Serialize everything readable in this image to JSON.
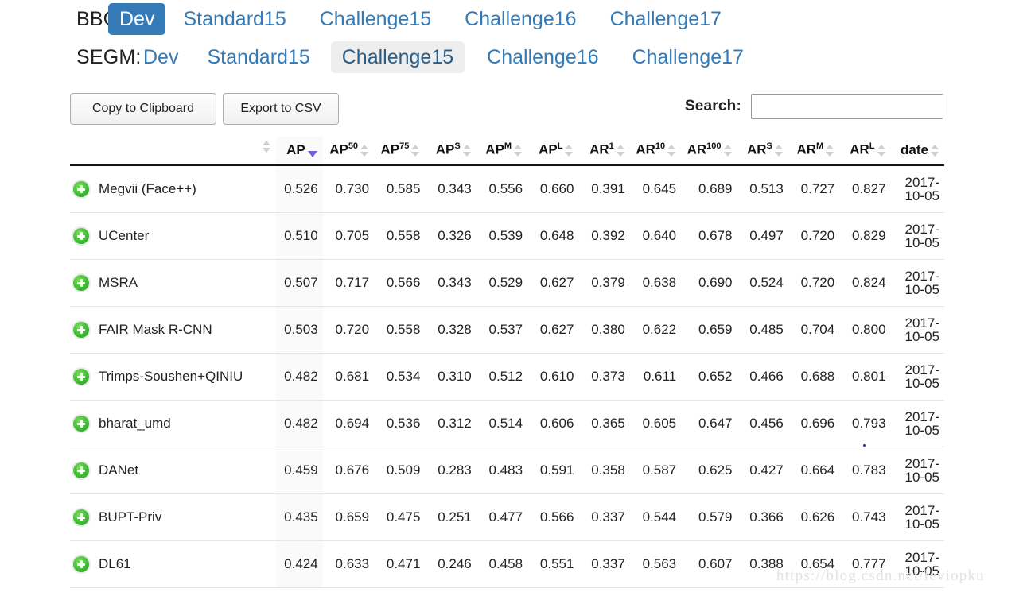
{
  "tab_rows": [
    {
      "label": "BBOX:",
      "tabs": [
        {
          "label": "Dev",
          "state": "active-primary"
        },
        {
          "label": "Standard15",
          "state": "link"
        },
        {
          "label": "Challenge15",
          "state": "link"
        },
        {
          "label": "Challenge16",
          "state": "link"
        },
        {
          "label": "Challenge17",
          "state": "link"
        }
      ]
    },
    {
      "label": "SEGM:",
      "tabs": [
        {
          "label": "Dev",
          "state": "link"
        },
        {
          "label": "Standard15",
          "state": "link"
        },
        {
          "label": "Challenge15",
          "state": "active-muted"
        },
        {
          "label": "Challenge16",
          "state": "link"
        },
        {
          "label": "Challenge17",
          "state": "link"
        }
      ]
    }
  ],
  "toolbar": {
    "copy_label": "Copy to Clipboard",
    "export_label": "Export to CSV",
    "search_label": "Search:",
    "search_value": "",
    "search_placeholder": ""
  },
  "table": {
    "columns": [
      {
        "key": "name",
        "label": "",
        "sup": "",
        "sort": "none"
      },
      {
        "key": "ap",
        "label": "AP",
        "sup": "",
        "sort": "desc"
      },
      {
        "key": "ap50",
        "label": "AP",
        "sup": "50",
        "sort": "none"
      },
      {
        "key": "ap75",
        "label": "AP",
        "sup": "75",
        "sort": "none"
      },
      {
        "key": "aps",
        "label": "AP",
        "sup": "S",
        "sort": "none"
      },
      {
        "key": "apm",
        "label": "AP",
        "sup": "M",
        "sort": "none"
      },
      {
        "key": "apl",
        "label": "AP",
        "sup": "L",
        "sort": "none"
      },
      {
        "key": "ar1",
        "label": "AR",
        "sup": "1",
        "sort": "none"
      },
      {
        "key": "ar10",
        "label": "AR",
        "sup": "10",
        "sort": "none"
      },
      {
        "key": "ar100",
        "label": "AR",
        "sup": "100",
        "sort": "none"
      },
      {
        "key": "ars",
        "label": "AR",
        "sup": "S",
        "sort": "none"
      },
      {
        "key": "arm",
        "label": "AR",
        "sup": "M",
        "sort": "none"
      },
      {
        "key": "arl",
        "label": "AR",
        "sup": "L",
        "sort": "none"
      },
      {
        "key": "date",
        "label": "date",
        "sup": "",
        "sort": "none"
      }
    ],
    "rows": [
      {
        "name": "Megvii (Face++)",
        "ap": "0.526",
        "ap50": "0.730",
        "ap75": "0.585",
        "aps": "0.343",
        "apm": "0.556",
        "apl": "0.660",
        "ar1": "0.391",
        "ar10": "0.645",
        "ar100": "0.689",
        "ars": "0.513",
        "arm": "0.727",
        "arl": "0.827",
        "date": "2017-10-05"
      },
      {
        "name": "UCenter",
        "ap": "0.510",
        "ap50": "0.705",
        "ap75": "0.558",
        "aps": "0.326",
        "apm": "0.539",
        "apl": "0.648",
        "ar1": "0.392",
        "ar10": "0.640",
        "ar100": "0.678",
        "ars": "0.497",
        "arm": "0.720",
        "arl": "0.829",
        "date": "2017-10-05"
      },
      {
        "name": "MSRA",
        "ap": "0.507",
        "ap50": "0.717",
        "ap75": "0.566",
        "aps": "0.343",
        "apm": "0.529",
        "apl": "0.627",
        "ar1": "0.379",
        "ar10": "0.638",
        "ar100": "0.690",
        "ars": "0.524",
        "arm": "0.720",
        "arl": "0.824",
        "date": "2017-10-05"
      },
      {
        "name": "FAIR Mask R-CNN",
        "ap": "0.503",
        "ap50": "0.720",
        "ap75": "0.558",
        "aps": "0.328",
        "apm": "0.537",
        "apl": "0.627",
        "ar1": "0.380",
        "ar10": "0.622",
        "ar100": "0.659",
        "ars": "0.485",
        "arm": "0.704",
        "arl": "0.800",
        "date": "2017-10-05"
      },
      {
        "name": "Trimps-Soushen+QINIU",
        "ap": "0.482",
        "ap50": "0.681",
        "ap75": "0.534",
        "aps": "0.310",
        "apm": "0.512",
        "apl": "0.610",
        "ar1": "0.373",
        "ar10": "0.611",
        "ar100": "0.652",
        "ars": "0.466",
        "arm": "0.688",
        "arl": "0.801",
        "date": "2017-10-05"
      },
      {
        "name": "bharat_umd",
        "ap": "0.482",
        "ap50": "0.694",
        "ap75": "0.536",
        "aps": "0.312",
        "apm": "0.514",
        "apl": "0.606",
        "ar1": "0.365",
        "ar10": "0.605",
        "ar100": "0.647",
        "ars": "0.456",
        "arm": "0.696",
        "arl": "0.793",
        "date": "2017-10-05"
      },
      {
        "name": "DANet",
        "ap": "0.459",
        "ap50": "0.676",
        "ap75": "0.509",
        "aps": "0.283",
        "apm": "0.483",
        "apl": "0.591",
        "ar1": "0.358",
        "ar10": "0.587",
        "ar100": "0.625",
        "ars": "0.427",
        "arm": "0.664",
        "arl": "0.783",
        "date": "2017-10-05"
      },
      {
        "name": "BUPT-Priv",
        "ap": "0.435",
        "ap50": "0.659",
        "ap75": "0.475",
        "aps": "0.251",
        "apm": "0.477",
        "apl": "0.566",
        "ar1": "0.337",
        "ar10": "0.544",
        "ar100": "0.579",
        "ars": "0.366",
        "arm": "0.626",
        "arl": "0.743",
        "date": "2017-10-05"
      },
      {
        "name": "DL61",
        "ap": "0.424",
        "ap50": "0.633",
        "ap75": "0.471",
        "aps": "0.246",
        "apm": "0.458",
        "apl": "0.551",
        "ar1": "0.337",
        "ar10": "0.563",
        "ar100": "0.607",
        "ars": "0.388",
        "arm": "0.654",
        "arl": "0.777",
        "date": "2017-10-05"
      }
    ]
  },
  "watermark": "https://blog.csdn.net/leviopku",
  "colors": {
    "link": "#337ab7",
    "active_tab_bg": "#337ab7",
    "muted_tab_bg": "#eeeeee",
    "sorted_col_bg": "#fafafa",
    "sort_arrow_active": "#6e62d6",
    "plus_icon_green": "#3ebd33"
  }
}
